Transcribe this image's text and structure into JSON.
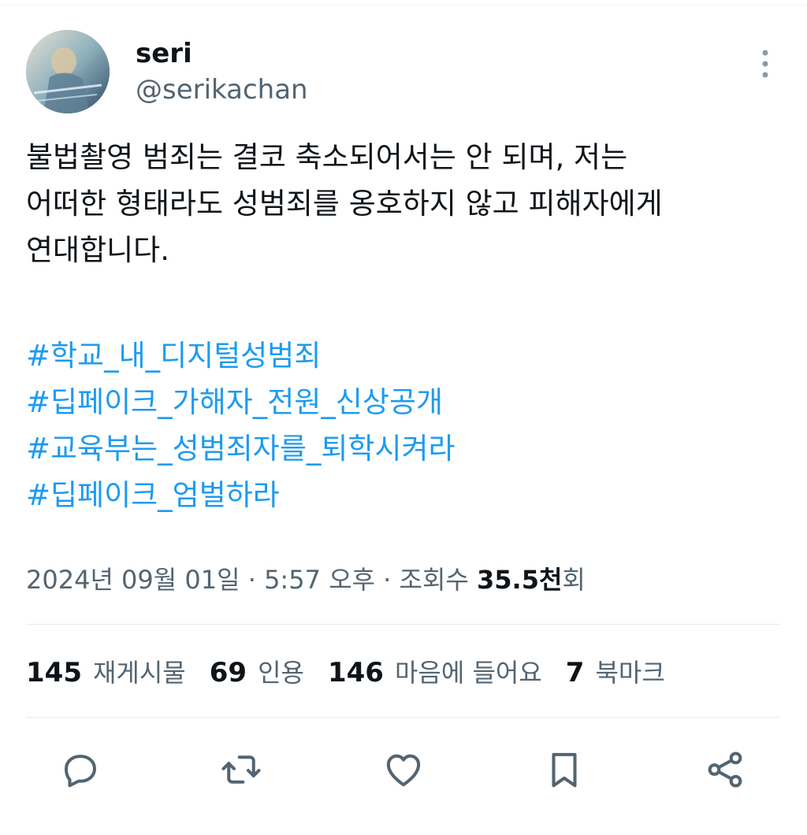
{
  "author": {
    "name": "seri",
    "handle": "@serikachan",
    "avatar_icon": "avatar-illustration"
  },
  "tweet": {
    "lines": [
      "불법촬영 범죄는 결코 축소되어서는 안 되며, 저는",
      "어떠한 형태라도 성범죄를 옹호하지 않고 피해자에게",
      "연대합니다."
    ],
    "hashtags": [
      "#학교_내_디지털성범죄",
      "#딥페이크_가해자_전원_신상공개",
      "#교육부는_성범죄자를_퇴학시켜라",
      "#딥페이크_엄벌하라"
    ]
  },
  "meta": {
    "date": "2024년 09월 01일",
    "time": "5:57 오후",
    "separator": "·",
    "views_label_prefix": "조회수",
    "views_count": "35.5천",
    "views_label_suffix": "회"
  },
  "stats": {
    "retweets": {
      "count": "145",
      "label": "재게시물"
    },
    "quotes": {
      "count": "69",
      "label": "인용"
    },
    "likes": {
      "count": "146",
      "label": "마음에 들어요"
    },
    "bookmarks": {
      "count": "7",
      "label": "북마크"
    }
  },
  "actions": {
    "reply_icon": "reply-icon",
    "retweet_icon": "retweet-icon",
    "like_icon": "heart-icon",
    "bookmark_icon": "bookmark-icon",
    "share_icon": "share-icon"
  },
  "colors": {
    "text": "#0f1419",
    "secondary": "#536471",
    "link": "#1d9bf0",
    "divider": "#e6ecf0"
  }
}
